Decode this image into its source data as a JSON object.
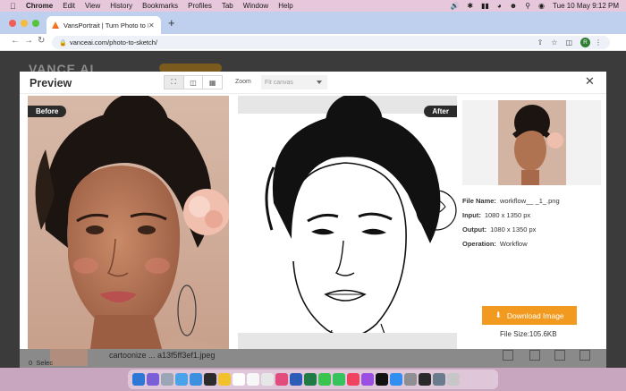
{
  "menubar": {
    "app": "Chrome",
    "items": [
      "Edit",
      "View",
      "History",
      "Bookmarks",
      "Profiles",
      "Tab",
      "Window",
      "Help"
    ],
    "clock": "Tue 10 May  9:12 PM",
    "icons": [
      "speaker-icon",
      "bluetooth-icon",
      "battery-icon",
      "wifi-icon",
      "user-icon",
      "search-icon",
      "control-center-icon"
    ]
  },
  "browser": {
    "tab_title": "VansPortrait | Turn Photo to Line",
    "url": "vanceai.com/photo-to-sketch/",
    "profile_initial": "R"
  },
  "page": {
    "logo": "VANCE AI",
    "list_item": {
      "filename": "cartoonize ... a13f5ff3ef1.jpeg",
      "selected_count": "0",
      "selected_label": "Selec"
    }
  },
  "modal": {
    "title": "Preview",
    "zoom_label": "Zoom",
    "zoom_placeholder": "Fit canvas",
    "before_label": "Before",
    "after_label": "After",
    "file_info": {
      "file_name_label": "File Name:",
      "file_name": "workflow__ _1_.png",
      "input_label": "Input:",
      "input": "1080 x 1350 px",
      "output_label": "Output:",
      "output": "1080 x 1350 px",
      "operation_label": "Operation:",
      "operation": "Workflow"
    },
    "download_label": "Download Image",
    "file_size": "File Size:105.6KB"
  },
  "colors": {
    "accent": "#f19a1f",
    "badge": "#2b2b2b",
    "menubar": "#e7c7dc",
    "tabstrip": "#bfd0ee"
  }
}
